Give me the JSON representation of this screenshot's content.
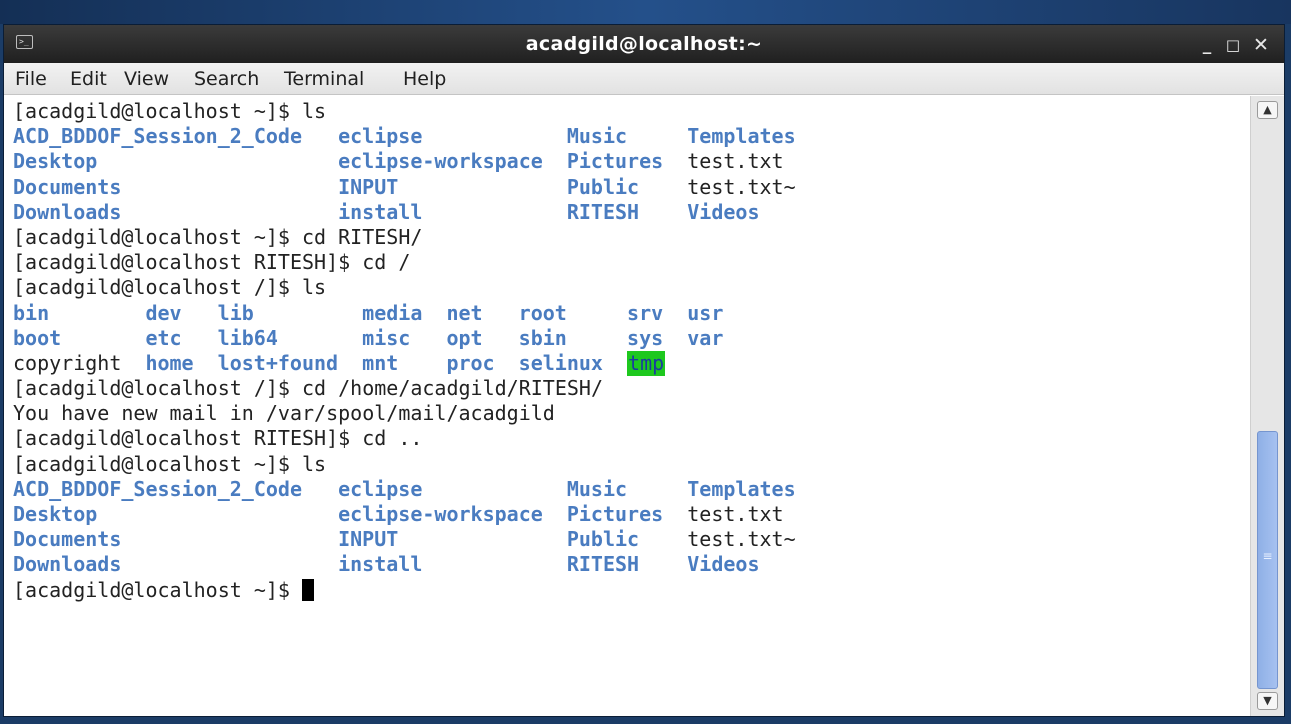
{
  "window": {
    "title": "acadgild@localhost:~"
  },
  "titlebar": {
    "app_icon": "terminal-icon",
    "minimize": "_",
    "maximize": "□",
    "close": "✕"
  },
  "menu": [
    "File",
    "Edit",
    "View",
    "Search",
    "Terminal",
    "Help"
  ],
  "colors": {
    "directory": "#4a7cc0",
    "text": "#222222",
    "tmp_highlight": "#1ec81e",
    "titlebar": "#2b2b2b"
  },
  "terminal": {
    "lines": [
      {
        "segments": [
          {
            "text": "[acadgild@localhost ~]$ ls"
          }
        ]
      },
      {
        "segments": [
          {
            "text": "ACD_BDDOF_Session_2_Code",
            "col": 0,
            "dir": true
          },
          {
            "text": "eclipse",
            "col": 27,
            "dir": true
          },
          {
            "text": "Music",
            "col": 46,
            "dir": true
          },
          {
            "text": "Templates",
            "col": 56,
            "dir": true
          }
        ]
      },
      {
        "segments": [
          {
            "text": "Desktop",
            "col": 0,
            "dir": true
          },
          {
            "text": "eclipse-workspace",
            "col": 27,
            "dir": true
          },
          {
            "text": "Pictures",
            "col": 46,
            "dir": true
          },
          {
            "text": "test.txt",
            "col": 56
          }
        ]
      },
      {
        "segments": [
          {
            "text": "Documents",
            "col": 0,
            "dir": true
          },
          {
            "text": "INPUT",
            "col": 27,
            "dir": true
          },
          {
            "text": "Public",
            "col": 46,
            "dir": true
          },
          {
            "text": "test.txt~",
            "col": 56
          }
        ]
      },
      {
        "segments": [
          {
            "text": "Downloads",
            "col": 0,
            "dir": true
          },
          {
            "text": "install",
            "col": 27,
            "dir": true
          },
          {
            "text": "RITESH",
            "col": 46,
            "dir": true
          },
          {
            "text": "Videos",
            "col": 56,
            "dir": true
          }
        ]
      },
      {
        "segments": [
          {
            "text": "[acadgild@localhost ~]$ cd RITESH/"
          }
        ]
      },
      {
        "segments": [
          {
            "text": "[acadgild@localhost RITESH]$ cd /"
          }
        ]
      },
      {
        "segments": [
          {
            "text": "[acadgild@localhost /]$ ls"
          }
        ]
      },
      {
        "segments": [
          {
            "text": "bin",
            "col": 0,
            "dir": true
          },
          {
            "text": "dev",
            "col": 11,
            "dir": true
          },
          {
            "text": "lib",
            "col": 17,
            "dir": true
          },
          {
            "text": "media",
            "col": 29,
            "dir": true
          },
          {
            "text": "net",
            "col": 36,
            "dir": true
          },
          {
            "text": "root",
            "col": 42,
            "dir": true
          },
          {
            "text": "srv",
            "col": 51,
            "dir": true
          },
          {
            "text": "usr",
            "col": 56,
            "dir": true
          }
        ]
      },
      {
        "segments": [
          {
            "text": "boot",
            "col": 0,
            "dir": true
          },
          {
            "text": "etc",
            "col": 11,
            "dir": true
          },
          {
            "text": "lib64",
            "col": 17,
            "dir": true
          },
          {
            "text": "misc",
            "col": 29,
            "dir": true
          },
          {
            "text": "opt",
            "col": 36,
            "dir": true
          },
          {
            "text": "sbin",
            "col": 42,
            "dir": true
          },
          {
            "text": "sys",
            "col": 51,
            "dir": true
          },
          {
            "text": "var",
            "col": 56,
            "dir": true
          }
        ]
      },
      {
        "segments": [
          {
            "text": "copyright",
            "col": 0
          },
          {
            "text": "home",
            "col": 11,
            "dir": true
          },
          {
            "text": "lost+found",
            "col": 17,
            "dir": true
          },
          {
            "text": "mnt",
            "col": 29,
            "dir": true
          },
          {
            "text": "proc",
            "col": 36,
            "dir": true
          },
          {
            "text": "selinux",
            "col": 42,
            "dir": true
          },
          {
            "text": "tmp",
            "col": 51,
            "tmp": true
          }
        ]
      },
      {
        "segments": [
          {
            "text": "[acadgild@localhost /]$ cd /home/acadgild/RITESH/"
          }
        ]
      },
      {
        "segments": [
          {
            "text": "You have new mail in /var/spool/mail/acadgild"
          }
        ]
      },
      {
        "segments": [
          {
            "text": "[acadgild@localhost RITESH]$ cd .."
          }
        ]
      },
      {
        "segments": [
          {
            "text": "[acadgild@localhost ~]$ ls"
          }
        ]
      },
      {
        "segments": [
          {
            "text": "ACD_BDDOF_Session_2_Code",
            "col": 0,
            "dir": true
          },
          {
            "text": "eclipse",
            "col": 27,
            "dir": true
          },
          {
            "text": "Music",
            "col": 46,
            "dir": true
          },
          {
            "text": "Templates",
            "col": 56,
            "dir": true
          }
        ]
      },
      {
        "segments": [
          {
            "text": "Desktop",
            "col": 0,
            "dir": true
          },
          {
            "text": "eclipse-workspace",
            "col": 27,
            "dir": true
          },
          {
            "text": "Pictures",
            "col": 46,
            "dir": true
          },
          {
            "text": "test.txt",
            "col": 56
          }
        ]
      },
      {
        "segments": [
          {
            "text": "Documents",
            "col": 0,
            "dir": true
          },
          {
            "text": "INPUT",
            "col": 27,
            "dir": true
          },
          {
            "text": "Public",
            "col": 46,
            "dir": true
          },
          {
            "text": "test.txt~",
            "col": 56
          }
        ]
      },
      {
        "segments": [
          {
            "text": "Downloads",
            "col": 0,
            "dir": true
          },
          {
            "text": "install",
            "col": 27,
            "dir": true
          },
          {
            "text": "RITESH",
            "col": 46,
            "dir": true
          },
          {
            "text": "Videos",
            "col": 56,
            "dir": true
          }
        ]
      },
      {
        "segments": [
          {
            "text": "[acadgild@localhost ~]$ "
          }
        ],
        "cursor": true
      }
    ]
  },
  "scrollbar": {
    "up_icon": "chevron-up-icon",
    "down_icon": "chevron-down-icon",
    "position": 0.58
  }
}
